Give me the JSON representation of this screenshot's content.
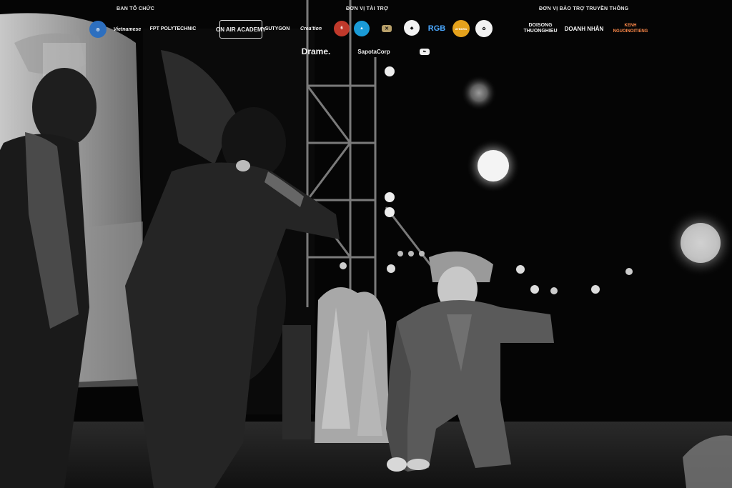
{
  "sponsors": {
    "organizers": {
      "title": "BAN TỔ CHỨC",
      "logos": [
        "Vietnamese",
        "FPT POLYTECHNIC"
      ]
    },
    "sponsors": {
      "title": "ĐƠN VỊ TÀI TRỢ",
      "logos": [
        "ON AIR ACADEMY",
        "SUTYGON",
        "Crea'tion",
        "RGB",
        "ATBDRA",
        "Drame.",
        "SapotaCorp"
      ]
    },
    "media": {
      "title": "ĐƠN VỊ BẢO TRỢ TRUYỀN THÔNG",
      "logos": [
        "DOISONG THUONGHIEU",
        "DOANH NHÂN",
        "KENH NGUOINOITIENG"
      ]
    }
  },
  "colors": {
    "background": "#000000",
    "logo": "#f2f2f2"
  }
}
